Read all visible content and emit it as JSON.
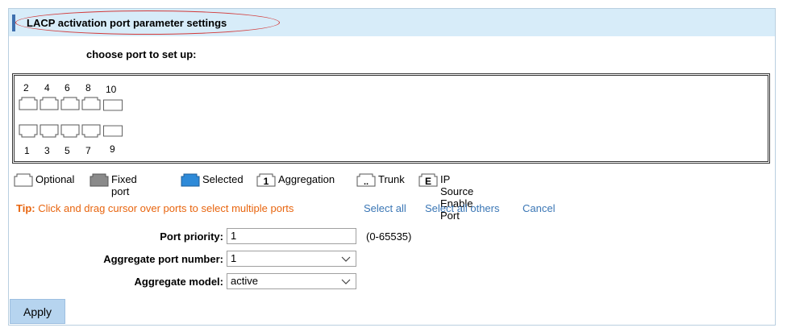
{
  "header": {
    "title": "LACP activation port parameter settings"
  },
  "choose_label": "choose port to set up:",
  "ports": {
    "top": [
      {
        "num": "2",
        "type": "copper"
      },
      {
        "num": "4",
        "type": "copper"
      },
      {
        "num": "6",
        "type": "copper"
      },
      {
        "num": "8",
        "type": "copper"
      },
      {
        "num": "10",
        "type": "fiber"
      }
    ],
    "bottom": [
      {
        "num": "1",
        "type": "copper"
      },
      {
        "num": "3",
        "type": "copper"
      },
      {
        "num": "5",
        "type": "copper"
      },
      {
        "num": "7",
        "type": "copper"
      },
      {
        "num": "9",
        "type": "fiber"
      }
    ]
  },
  "legend": {
    "optional": "Optional",
    "fixed": "Fixed port",
    "selected": "Selected",
    "aggregation": "Aggregation",
    "aggregation_glyph": "1",
    "trunk": "Trunk",
    "trunk_glyph": "..",
    "ipsource": "IP Source Enable Port",
    "ipsource_glyph": "E"
  },
  "tip": {
    "label": "Tip:",
    "message": "Click and drag cursor over ports to select multiple ports",
    "select_all": "Select all",
    "select_others": "Select all others",
    "cancel": "Cancel"
  },
  "form": {
    "priority_label": "Port priority:",
    "priority_value": "1",
    "priority_range": "(0-65535)",
    "agg_port_label": "Aggregate port number:",
    "agg_port_value": "1",
    "agg_model_label": "Aggregate model:",
    "agg_model_value": "active"
  },
  "apply_label": "Apply",
  "colors": {
    "header_bg": "#d7ecf9",
    "accent": "#3e6fae",
    "tip": "#e8650f",
    "link": "#3a76b5",
    "selected": "#2e8ad8"
  }
}
